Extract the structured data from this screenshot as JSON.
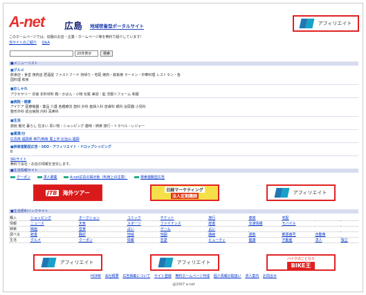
{
  "header": {
    "logo_text": "A-net",
    "city": "広島",
    "tagline": "地域密着型ポータルサイト",
    "intro": "このホームページでは、協働のお店・企業・ホームページ等を無料で紹介しています！",
    "links": [
      "当サイトのご紹介",
      "Q&A"
    ]
  },
  "affiliate": {
    "label": "アフィリエイト"
  },
  "search": {
    "value": "",
    "select_value": "20件表示",
    "button_label": "検索"
  },
  "menu": {
    "heading": "■メニューリスト",
    "categories": [
      {
        "title": "■グルメ",
        "items": "飲食店・食堂 焼肉店 居酒屋 ファストフード 持帰り・宅配 焼肉・鉄板焼 ラーメン・中華料理 レストラン・各国料理 和食"
      },
      {
        "title": "■おしゃれ",
        "items": "アクセサリー 衣装 衣料材料 鞄・かばん・小物 化粧 美容・髪 洋服リフォーム 和服"
      },
      {
        "title": "■病院・健康",
        "items": "アイケア 医療機器・薬品 介護 各種療法 歯科 外科 産婦人科 皮膚科 眼科 泌尿器 小児科 整形外科 総合病院 内科 耳鼻科"
      },
      {
        "title": "■生活",
        "items": "旅館 観光 暮らし 住まい 買い物・ショッピング 趣味・娯楽 旅行・トラベル・レジャー"
      },
      {
        "title": "■賃貸/分",
        "items": "広島県 福岡県 神戸/西条 尾上市 比治山 福岡"
      },
      {
        "title": "■検索連動型広告・SEO・アフィリエイト・ドロップシッピング",
        "items": "B"
      }
    ],
    "sub_link": "SR/サイト",
    "sub_text": "無料で会社・お店の情報を宣伝します。"
  },
  "service": {
    "heading": "■生活情報サイト",
    "links": [
      "クーポン",
      "求人募集",
      "A-net広島の掲示板（利用上の注意）",
      "検索連動型広告"
    ]
  },
  "banners": {
    "jtb_mark": "JTB",
    "jtb_text": "海外ツアー",
    "nikkei_top": "日経マーケティング",
    "nikkei_bottom": "法人定期購読",
    "bike_top": "バイクのことなら",
    "bike_main": "BIKE王"
  },
  "link_table": {
    "heading": "■生活便利リンクサイト",
    "rows": [
      {
        "label": "購入",
        "cells": [
          "ショッピング",
          "オークション",
          "コミック",
          "チケット",
          "旅行",
          "車検",
          "宅配"
        ]
      },
      {
        "label": "情報",
        "cells": [
          "ニュース",
          "天気",
          "スポーツ",
          "ファイナンス",
          "辞書",
          "交通情報",
          "モバイル"
        ]
      },
      {
        "label": "娯楽",
        "cells": [
          "映画",
          "音楽",
          "占い",
          "ゲーム",
          "占い",
          "",
          ""
        ]
      },
      {
        "label": "調べる",
        "cells": [
          "辞書",
          "翻訳",
          "地域",
          "地図",
          "路線",
          "運勢",
          "郵便番号",
          "自動車"
        ]
      },
      {
        "label": "生活",
        "cells": [
          "グルメ",
          "クーポン",
          "情報",
          "恋愛",
          "ビューティ",
          "健康",
          "不動産",
          "求人",
          "独立"
        ]
      }
    ]
  },
  "footer": {
    "links": [
      "HOME",
      "会社概要",
      "広告掲載について",
      "サイト登録",
      "無料ホームページ作成",
      "個人情報の取扱い",
      "求人案内",
      "お問合せ"
    ],
    "copyright": "@2007 a-net"
  }
}
